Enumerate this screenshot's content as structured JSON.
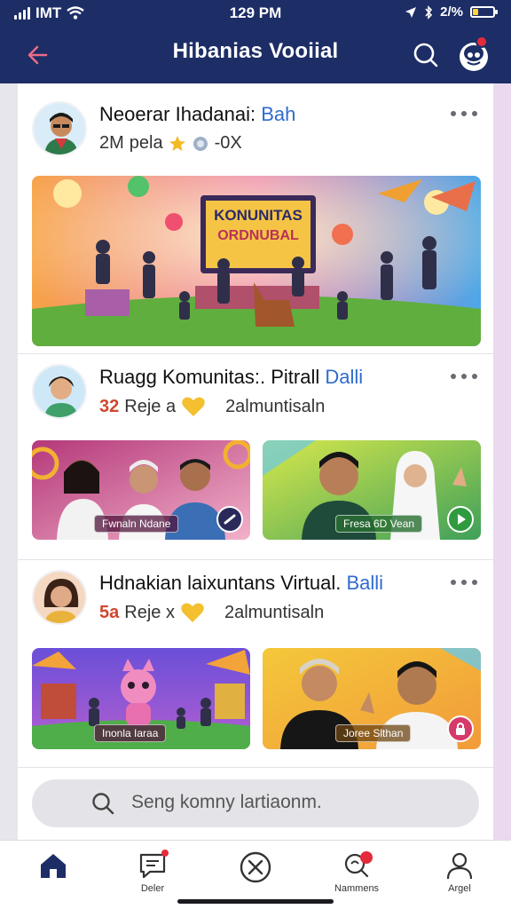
{
  "status_bar": {
    "carrier": "IMT",
    "time": "129 PM",
    "battery_text": "2/%",
    "battery_level": 0.25
  },
  "header": {
    "title": "Hibanias Vooiial",
    "back_icon": "arrow-left-icon",
    "search_icon": "search-icon",
    "profile_icon": "avatar-icon",
    "accent": "#1d2d66"
  },
  "posts": [
    {
      "author": "Neoerar Ihadanai:",
      "tag": "Bah",
      "meta_count": "2M",
      "meta_text": "pela",
      "meta_extra": "-0X",
      "media": [
        {
          "title_line1": "KONUNITAS",
          "title_line2": "ORDNUBAL"
        }
      ]
    },
    {
      "author": "Ruagg Komunitas:. Pitrall",
      "tag": "Dalli",
      "meta_count": "32",
      "meta_text": "Reje a",
      "meta_extra": "2almuntisaln",
      "media": [
        {
          "caption": "Fwnaln Ndane"
        },
        {
          "caption": "Fresa 6D Vean"
        }
      ]
    },
    {
      "author": "Hdnakian laixuntans Virtual.",
      "tag": "Balli",
      "meta_count": "5a",
      "meta_text": "Reje x",
      "meta_extra": "2almuntisaln",
      "media": [
        {
          "caption": "Inonla Iaraa"
        },
        {
          "caption": "Joree Slthan"
        }
      ]
    }
  ],
  "search": {
    "placeholder": "Seng komny lartiaonm."
  },
  "bottom_nav": [
    {
      "icon": "home-icon",
      "label": ""
    },
    {
      "icon": "message-icon",
      "label": "Deler"
    },
    {
      "icon": "close-circle-icon",
      "label": ""
    },
    {
      "icon": "notification-icon",
      "label": "Nammens"
    },
    {
      "icon": "profile-icon",
      "label": "Argel"
    }
  ]
}
